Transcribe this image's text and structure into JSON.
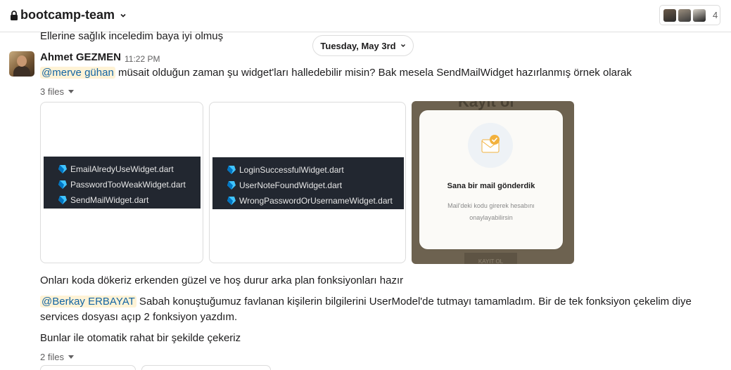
{
  "header": {
    "channel_name": "bootcamp-team",
    "member_count": "4"
  },
  "messages": {
    "prev_line": "Ellerine sağlık inceledim baya iyi olmuş",
    "date_divider": "Tuesday, May 3rd",
    "author": "Ahmet GEZMEN",
    "time": "11:22 PM",
    "m1": {
      "mention": "@merve gühan",
      "text": " müsait olduğun zaman şu widget'ları halledebilir misin? Bak mesela SendMailWidget hazırlanmış örnek olarak"
    },
    "files_label_1": "3 files",
    "file1": {
      "rows": [
        "EmailAlredyUseWidget.dart",
        "PasswordTooWeakWidget.dart",
        "SendMailWidget.dart"
      ]
    },
    "file2": {
      "rows": [
        "LoginSuccessfulWidget.dart",
        "UserNoteFoundWidget.dart",
        "WrongPasswordOrUsernameWidget.dart"
      ]
    },
    "file3": {
      "bg_text": "Kayıt ol",
      "title": "Sana bir mail gönderdik",
      "subtitle": "Mail'deki kodu girerek hesabını onaylayabilirsin",
      "button": "KAYIT OL"
    },
    "m2": "Onları koda dökeriz erkenden güzel ve hoş durur arka plan fonksiyonları hazır",
    "m3": {
      "mention": "@Berkay ERBAYAT",
      "text": " Sabah konuştuğumuz favlanan kişilerin bilgilerini UserModel'de tutmayı tamamladım. Bir de tek fonksiyon çekelim diye services dosyası açıp 2 fonksiyon yazdım."
    },
    "m4": "Bunlar ile otomatik rahat bir şekilde çekeriz",
    "files_label_2": "2 files"
  },
  "colors": {
    "mention_bg": "#fff3d6",
    "mention_fg": "#1264a3",
    "code_bg": "#222730",
    "dart_blue": "#40c4ff"
  }
}
